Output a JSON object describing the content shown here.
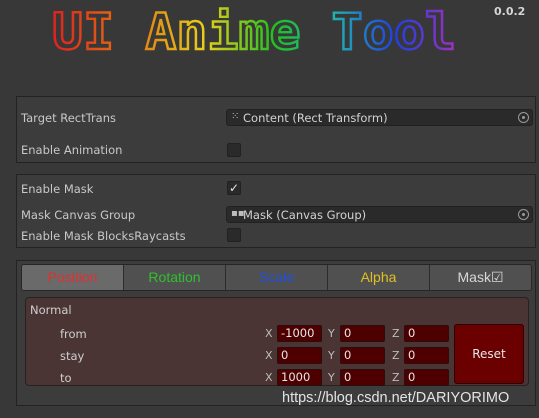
{
  "header": {
    "logo_text": "UI Anime Tool",
    "logo_colors": [
      "#e02020",
      "#e07a10",
      "#e8d018",
      "#20c020",
      "#20b0b0",
      "#2040e0",
      "#a030c0"
    ],
    "version": "0.0.2"
  },
  "section1": {
    "target_label": "Target RectTrans",
    "target_value": "Content (Rect Transform)",
    "target_icon": "rect-transform-icon",
    "enable_animation_label": "Enable Animation",
    "enable_animation_checked": false
  },
  "section2": {
    "enable_mask_label": "Enable Mask",
    "enable_mask_checked": true,
    "mask_group_label": "Mask Canvas Group",
    "mask_group_value": "Mask (Canvas Group)",
    "mask_group_icon": "canvas-group-icon",
    "blocks_raycasts_label": "Enable Mask BlocksRaycasts",
    "blocks_raycasts_checked": false
  },
  "tabs": [
    {
      "label": "Position",
      "color": "#e03030",
      "active": true
    },
    {
      "label": "Rotation",
      "color": "#30c030",
      "active": false
    },
    {
      "label": "Scale",
      "color": "#2050e0",
      "active": false
    },
    {
      "label": "Alpha",
      "color": "#e0c020",
      "active": false
    },
    {
      "label": "Mask☑",
      "color": "#d8d8d8",
      "active": false
    }
  ],
  "position_panel": {
    "group_label": "Normal",
    "axis_labels": [
      "X",
      "Y",
      "Z"
    ],
    "rows": [
      {
        "label": "from",
        "x": "-1000",
        "y": "0",
        "z": "0"
      },
      {
        "label": "stay",
        "x": "0",
        "y": "0",
        "z": "0"
      },
      {
        "label": "to",
        "x": "1000",
        "y": "0",
        "z": "0"
      }
    ],
    "reset_label": "Reset"
  },
  "watermark": "https://blog.csdn.net/DARIYORIMO"
}
